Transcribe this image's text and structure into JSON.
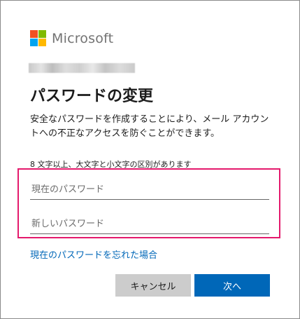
{
  "brand": {
    "name": "Microsoft"
  },
  "page": {
    "title": "パスワードの変更",
    "description": "安全なパスワードを作成することにより、メール アカウントへの不正なアクセスを防ぐことができます。",
    "hint": "8 文字以上、大文字と小文字の区別があります"
  },
  "form": {
    "current_password": {
      "placeholder": "現在のパスワード",
      "value": ""
    },
    "new_password": {
      "placeholder": "新しいパスワード",
      "value": ""
    }
  },
  "links": {
    "forgot_password": "現在のパスワードを忘れた場合"
  },
  "buttons": {
    "cancel": "キャンセル",
    "next": "次へ"
  },
  "colors": {
    "accent": "#0067b8",
    "highlight_border": "#e4196c",
    "cancel_button": "#cccccc",
    "logo": [
      "#f25022",
      "#7fba00",
      "#00a4ef",
      "#ffb900"
    ]
  },
  "icons": {
    "logo": "microsoft-logo-icon"
  }
}
